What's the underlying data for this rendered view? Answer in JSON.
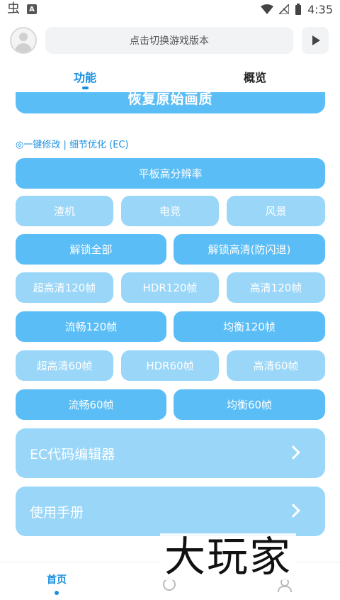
{
  "status_bar": {
    "time": "4:35",
    "icons": [
      "app-icon",
      "a-icon",
      "wifi-icon",
      "no-signal-icon",
      "battery-icon"
    ]
  },
  "top_bar": {
    "version_button_label": "点击切换游戏版本"
  },
  "tabs": [
    {
      "label": "功能",
      "active": true
    },
    {
      "label": "概览",
      "active": false
    }
  ],
  "restore_button_label": "恢复原始画质",
  "section_label": "◎一键修改 | 细节优化 (EC)",
  "buttons": {
    "tablet_resolution": "平板高分辨率",
    "potato": "渣机",
    "esports": "电竞",
    "scenery": "风景",
    "unlock_all": "解锁全部",
    "unlock_hd": "解锁高清(防闪退)",
    "uhd_120": "超高清120帧",
    "hdr_120": "HDR120帧",
    "hd_120": "高清120帧",
    "smooth_120": "流畅120帧",
    "balanced_120": "均衡120帧",
    "uhd_60": "超高清60帧",
    "hdr_60": "HDR60帧",
    "hd_60": "高清60帧",
    "smooth_60": "流畅60帧",
    "balanced_60": "均衡60帧"
  },
  "cards": {
    "ec_editor": "EC代码编辑器",
    "manual": "使用手册"
  },
  "bottom_nav": {
    "home_label": "首页"
  },
  "watermark_text": "大玩家",
  "colors": {
    "accent": "#1a8fe0",
    "button_dark": "#5bbdf5",
    "button_light": "#99d6f8"
  }
}
